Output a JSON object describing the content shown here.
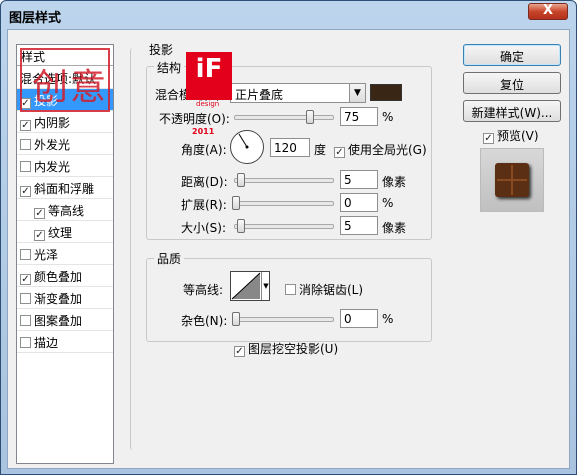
{
  "window": {
    "title": "图层样式",
    "close": "X"
  },
  "styles_panel": {
    "header": "样式",
    "items": [
      {
        "label": "混合选项:默认",
        "checkbox": false,
        "checked": false,
        "selected": false,
        "indent": false
      },
      {
        "label": "投影",
        "checkbox": true,
        "checked": true,
        "selected": true,
        "indent": false
      },
      {
        "label": "内阴影",
        "checkbox": true,
        "checked": true,
        "selected": false,
        "indent": false
      },
      {
        "label": "外发光",
        "checkbox": true,
        "checked": false,
        "selected": false,
        "indent": false
      },
      {
        "label": "内发光",
        "checkbox": true,
        "checked": false,
        "selected": false,
        "indent": false
      },
      {
        "label": "斜面和浮雕",
        "checkbox": true,
        "checked": true,
        "selected": false,
        "indent": false
      },
      {
        "label": "等高线",
        "checkbox": true,
        "checked": true,
        "selected": false,
        "indent": true
      },
      {
        "label": "纹理",
        "checkbox": true,
        "checked": true,
        "selected": false,
        "indent": true
      },
      {
        "label": "光泽",
        "checkbox": true,
        "checked": false,
        "selected": false,
        "indent": false
      },
      {
        "label": "颜色叠加",
        "checkbox": true,
        "checked": true,
        "selected": false,
        "indent": false
      },
      {
        "label": "渐变叠加",
        "checkbox": true,
        "checked": false,
        "selected": false,
        "indent": false
      },
      {
        "label": "图案叠加",
        "checkbox": true,
        "checked": false,
        "selected": false,
        "indent": false
      },
      {
        "label": "描边",
        "checkbox": true,
        "checked": false,
        "selected": false,
        "indent": false
      }
    ]
  },
  "drop_shadow": {
    "title": "投影",
    "structure_label": "结构",
    "blend_mode_label": "混合模式(B):",
    "blend_mode_value": "正片叠底",
    "shadow_color": "#3a2614",
    "opacity_label": "不透明度(O):",
    "opacity_value": "75",
    "opacity_unit": "%",
    "opacity_level": 75,
    "angle_label": "角度(A):",
    "angle_value": "120",
    "angle_unit": "度",
    "global_light_label": "使用全局光(G)",
    "global_light_checked": true,
    "distance_label": "距离(D):",
    "distance_value": "5",
    "distance_unit": "像素",
    "spread_label": "扩展(R):",
    "spread_value": "0",
    "spread_unit": "%",
    "size_label": "大小(S):",
    "size_value": "5",
    "size_unit": "像素",
    "quality_label": "品质",
    "contour_label": "等高线:",
    "antialias_label": "消除锯齿(L)",
    "antialias_checked": false,
    "noise_label": "杂色(N):",
    "noise_value": "0",
    "noise_unit": "%",
    "knockout_label": "图层挖空投影(U)",
    "knockout_checked": true
  },
  "buttons": {
    "ok": "确定",
    "reset": "复位",
    "new_style": "新建样式(W)...",
    "preview": "预览(V)",
    "preview_checked": true
  },
  "watermark": {
    "logo": "iF",
    "logo_sub": "design",
    "year": "2011",
    "stamp": "创意"
  }
}
